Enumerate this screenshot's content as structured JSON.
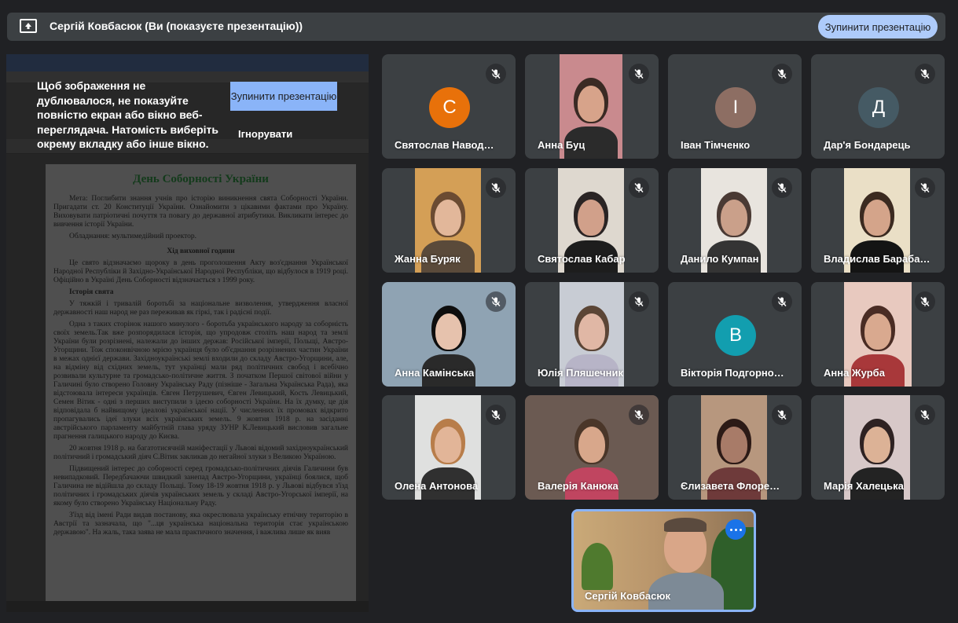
{
  "banner": {
    "title": "Сергій Ковбасюк (Ви (показуєте презентацію))",
    "stop_button": "Зупинити презентацію"
  },
  "share_warning": {
    "text": "Щоб зображення не дублювалося, не показуйте повністю екран або вікно веб-переглядача. Натомість виберіть окрему вкладку або інше вікно.",
    "stop_button": "Зупинити презентацію",
    "ignore_button": "Ігнорувати"
  },
  "document": {
    "title": "День Соборності України",
    "paragraphs": [
      "Мета: Поглибити знання учнів про історію виникнення свята Соборності України. Пригадати ст. 20 Конституції України. Ознайомити з цікавими фактами про Україну. Виховувати патріотичні почуття та повагу до державної атрибутики. Викликати інтерес до вивчення історії України.",
      "Обладнання: мультимедійний проектор."
    ],
    "section_title": "Хід виховної години",
    "body": [
      "Це свято відзначаємо щороку в день проголошення Акту воз'єднання Української Народної Республіки й Західно-Української Народної Республіки, що відбулося в 1919 році. Офіційно в Україні День Соборності відзначається з 1999 року.",
      "Історія свята",
      "У тяжкій і тривалій боротьбі за національне визволення, утвердження власної державності наш народ не раз переживав як гіркі, так і радісні події.",
      "Одна з таких сторінок нашого минулого - боротьба українського народу за соборність своїх земель.Так вже розпорядилася історія, що упродовж століть наш народ та землі України були розрізнені, належали до інших держав: Російської імперії, Польщі, Австро-Угорщини. Тож споконвічною мрією українця було об'єднання розрізнених частин України в межах однієї держави. Західноукраїнські землі входили до складу Австро-Угорщини, але, на відміну від східних земель, тут українці мали ряд політичних свобод і всебічно розвивали культурне та громадсько-політичне життя. З початком Першої світової війни у Галичині було створено Головну Українську Раду (пізніше - Загальна Українська Рада), яка відстоювала інтереси українців. Євген Петрушевич, Євген Левицький, Кость Левицький, Семен Вітик - одні з перших виступили з ідеєю соборності України. На їх думку, це дія відповідала б найвищому ідеалові української нації. У численних їх промовах відкрито пропагувались ідеї злуки всіх українських земель. 9 жовтня 1918 р. на засіданні австрійського парламенту майбутній глава уряду ЗУНР К.Левицький висловив загальне прагнення галицького народу до Києва.",
      "20 жовтня 1918 р. на багатотисячній маніфестації у Львові відомий західноукраїнський політичний і громадський діяч С.Вітик закликав до негайної злуки з Великою Україною.",
      "Підвищений інтерес до соборності серед громадсько-політичних діячів Галичини був невипадковий. Передбачаючи швидкий занепад Австро-Угорщини, українці боялися, щоб Галичина не відійшла до складу Польщі. Тому 18-19 жовтня 1918 р. у Львові відбувся з'їзд політичних і громадських діячів українських земель у складі Австро-Угорської імперії, на якому було створено Українську Національну Раду.",
      "З'їзд від імені Ради видав постанову, яка окреслювала українську етнічну територію в Австрії та зазначала, що \"...ця українська національна територія стає українською державою\". На жаль, така заява не мала практичного значення, і важлива лише як вияв"
    ]
  },
  "participants": [
    {
      "name": "Святослав Навод…",
      "avatar_letter": "С",
      "avatar_color": "#e8710a"
    },
    {
      "name": "Анна Буц"
    },
    {
      "name": "Іван Тімченко",
      "avatar_letter": "І",
      "avatar_color": "#8d6e63"
    },
    {
      "name": "Дар'я Бондарець",
      "avatar_letter": "Д",
      "avatar_color": "#455a64"
    },
    {
      "name": "Жанна Буряк"
    },
    {
      "name": "Святослав Кабар"
    },
    {
      "name": "Данило Кумпан"
    },
    {
      "name": "Владислав Бараба…"
    },
    {
      "name": "Анна Камінська"
    },
    {
      "name": "Юлія Пляшечник"
    },
    {
      "name": "Вікторія Подгорно…",
      "avatar_letter": "В",
      "avatar_color": "#129eaf"
    },
    {
      "name": "Анна Журба"
    },
    {
      "name": "Олена Антонова"
    },
    {
      "name": "Валерія Канюка"
    },
    {
      "name": "Єлизавета Флоре…"
    },
    {
      "name": "Марія Халецька"
    }
  ],
  "self_tile": {
    "name": "Сергій Ковбасюк"
  }
}
